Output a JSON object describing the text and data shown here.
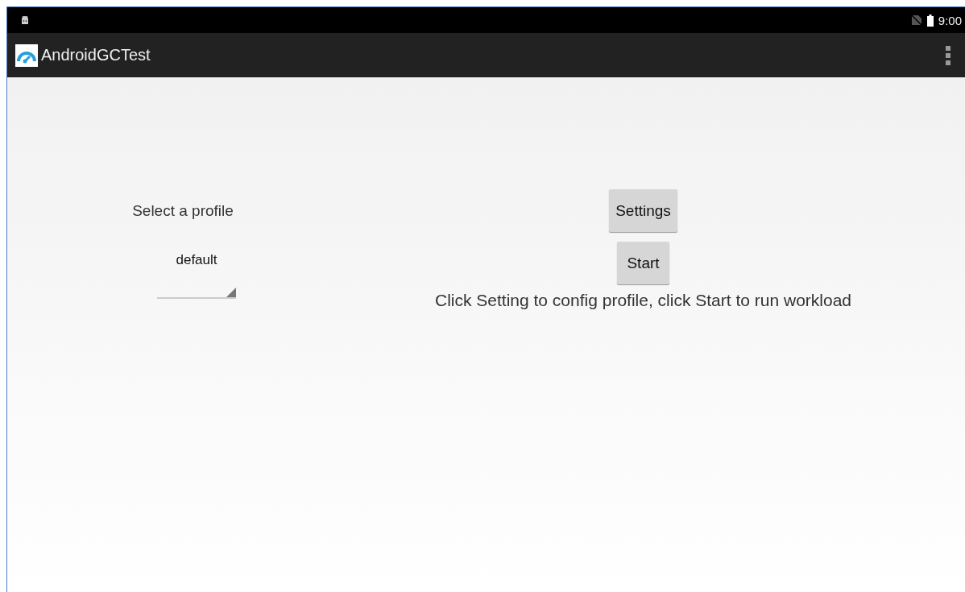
{
  "status_bar": {
    "time": "9:00"
  },
  "app_bar": {
    "title": "AndroidGCTest"
  },
  "profile": {
    "label": "Select a profile",
    "spinner_value": "default"
  },
  "buttons": [
    {
      "label": "Settings"
    },
    {
      "label": "Start"
    }
  ],
  "message": "Click Setting to config profile, click Start to run workload"
}
